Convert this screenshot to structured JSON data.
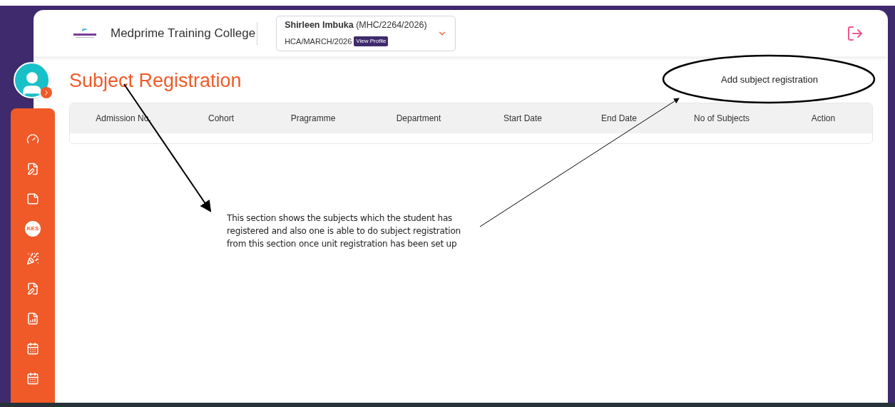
{
  "header": {
    "college": "Medprime Training College",
    "student_name": "Shirleen Imbuka",
    "student_id": "(MHC/2264/2026)",
    "cohort": "HCA/MARCH/2026",
    "profile_button": "View Profile"
  },
  "sidebar": {
    "items": [
      {
        "kind": "gauge"
      },
      {
        "kind": "edit"
      },
      {
        "kind": "note"
      },
      {
        "kind": "badge",
        "label": "KES"
      },
      {
        "kind": "party"
      },
      {
        "kind": "edit"
      },
      {
        "kind": "report"
      },
      {
        "kind": "calendar"
      },
      {
        "kind": "calendar"
      }
    ]
  },
  "page_title": "Subject Registration",
  "table": {
    "columns": [
      "Admission No.",
      "Cohort",
      "Pragramme",
      "Department",
      "Start Date",
      "End Date",
      "No of Subjects",
      "Action"
    ]
  },
  "annotations": {
    "callout": "Add subject registration",
    "note": "This section shows the subjects  which the student has registered and also one is able to do subject registration from this section once unit registration has been set up"
  }
}
